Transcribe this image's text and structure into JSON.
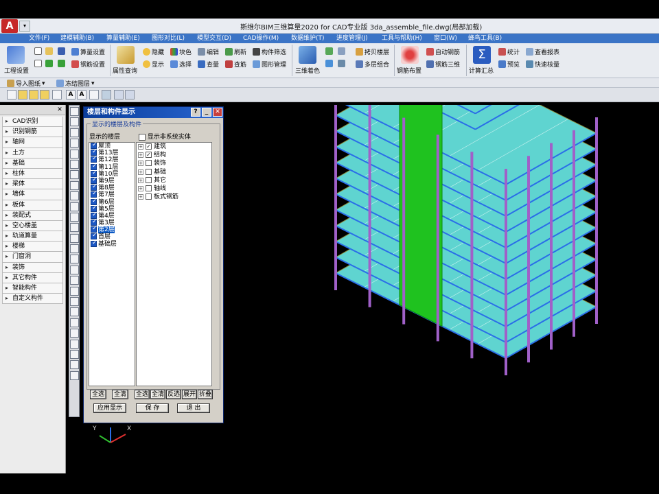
{
  "app": {
    "logo": "A",
    "window_title": "斯维尔BIM三维算量2020 for CAD专业版    3da_assemble_file.dwg(局部加载)"
  },
  "menu": [
    "文件(F)",
    "建模辅助(B)",
    "算量辅助(E)",
    "图形对比(L)",
    "模型交互(D)",
    "CAD操作(M)",
    "数据维护(T)",
    "进度管理(J)",
    "工具与帮助(H)",
    "窗口(W)",
    "蜂鸟工具(B)"
  ],
  "ribbon": {
    "project_settings": "工程设置",
    "calc_settings": "算量设置",
    "rebar_settings": "钢筋设置",
    "property_query": "属性查询",
    "hide": "隐藏",
    "block_color": "块色",
    "edit": "编辑",
    "refresh": "刷新",
    "component_filter": "构件筛选",
    "show": "显示",
    "select": "选择",
    "query_qty": "查量",
    "check_rebar": "查筋",
    "graphic_manage": "图形管理",
    "color_3d": "三维着色",
    "copy_floor": "拷贝楼层",
    "multi_floor_combine": "多层组合",
    "rebar_layout": "钢筋布置",
    "auto_rebar": "自动钢筋",
    "rebar_3d": "钢筋三维",
    "calc_summary": "计算汇总",
    "statistics": "统计",
    "view_report": "查看报表",
    "preview": "预览",
    "quick_check": "快速核量"
  },
  "toolbar2": {
    "import_drawing": "导入图纸",
    "freeze_layer": "冻结图层"
  },
  "left_panel": {
    "categories": [
      "CAD识别",
      "识别钢筋",
      "轴网",
      "土方",
      "基础",
      "柱体",
      "梁体",
      "墙体",
      "板体",
      "装配式",
      "空心楼盖",
      "轨道算量",
      "楼梯",
      "门窗洞",
      "装饰",
      "其它构件",
      "智能构件",
      "自定义构件"
    ]
  },
  "dialog": {
    "title": "楼层和构件显示",
    "group_label": "显示的楼层及构件",
    "floors_label": "显示的楼层",
    "non_system_label": "显示非系统实体",
    "floors": [
      {
        "name": "屋顶",
        "checked": true,
        "selected": false
      },
      {
        "name": "第13层",
        "checked": true,
        "selected": false
      },
      {
        "name": "第12层",
        "checked": true,
        "selected": false
      },
      {
        "name": "第11层",
        "checked": true,
        "selected": false
      },
      {
        "name": "第10层",
        "checked": true,
        "selected": false
      },
      {
        "name": "第9层",
        "checked": true,
        "selected": false
      },
      {
        "name": "第8层",
        "checked": true,
        "selected": false
      },
      {
        "name": "第7层",
        "checked": true,
        "selected": false
      },
      {
        "name": "第6层",
        "checked": true,
        "selected": false
      },
      {
        "name": "第5层",
        "checked": true,
        "selected": false
      },
      {
        "name": "第4层",
        "checked": true,
        "selected": false
      },
      {
        "name": "第3层",
        "checked": true,
        "selected": false
      },
      {
        "name": "第2层",
        "checked": true,
        "selected": true
      },
      {
        "name": "首层",
        "checked": true,
        "selected": false
      },
      {
        "name": "基础层",
        "checked": true,
        "selected": false
      }
    ],
    "components": [
      {
        "name": "建筑",
        "checked": true
      },
      {
        "name": "结构",
        "checked": true
      },
      {
        "name": "装饰",
        "checked": false
      },
      {
        "name": "基础",
        "checked": false
      },
      {
        "name": "其它",
        "checked": false
      },
      {
        "name": "轴线",
        "checked": false
      },
      {
        "name": "板式钢筋",
        "checked": false
      }
    ],
    "floor_buttons": [
      "全选",
      "全清"
    ],
    "comp_buttons": [
      "全选",
      "全清",
      "反选",
      "展开",
      "折叠"
    ],
    "apply_button": "应用显示",
    "save_button": "保 存",
    "exit_button": "退 出",
    "help_btn": "?",
    "min_btn": "_",
    "close_btn": "✕"
  },
  "colors": {
    "slab": "#5fd4d0",
    "column": "#a060c8",
    "beam_blue": "#2a6ee8",
    "wall_green": "#1fc21f",
    "edge_olive": "#8c8c3c",
    "axis_red": "#e03030",
    "axis_green": "#30c030"
  },
  "viewport": {
    "ucs_y": "Y",
    "ucs_x": "X"
  }
}
